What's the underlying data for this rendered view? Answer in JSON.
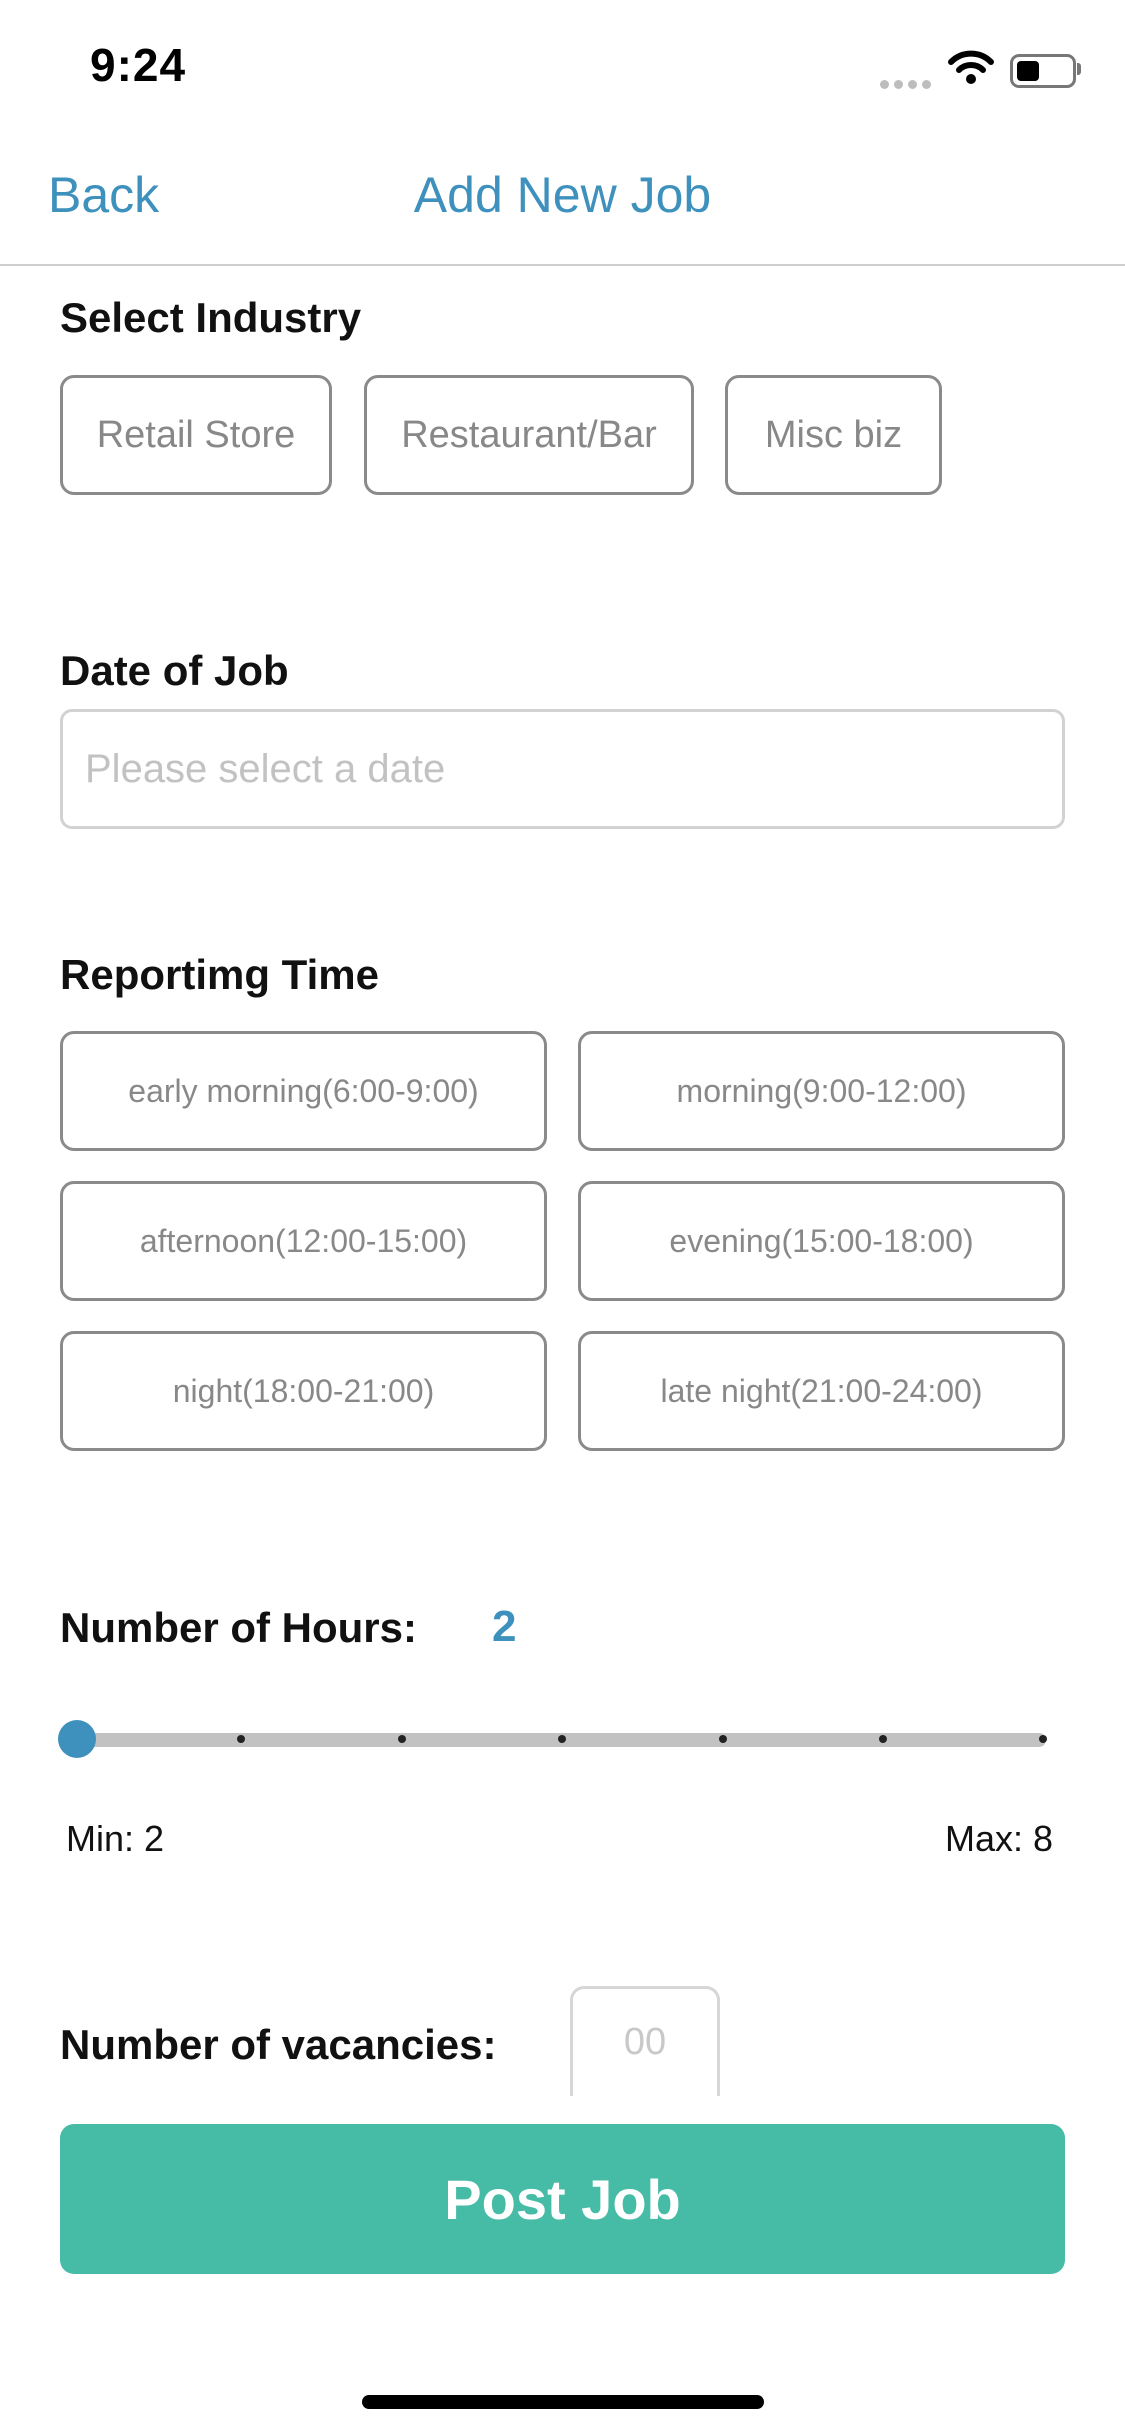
{
  "status_bar": {
    "time": "9:24"
  },
  "nav": {
    "back_label": "Back",
    "title": "Add New Job"
  },
  "industry": {
    "label": "Select Industry",
    "options": [
      "Retail Store",
      "Restaurant/Bar",
      "Misc biz"
    ]
  },
  "date": {
    "label": "Date of Job",
    "placeholder": "Please select a date"
  },
  "reporting": {
    "label": "Reportimg Time",
    "options": [
      "early morning(6:00-9:00)",
      "morning(9:00-12:00)",
      "afternoon(12:00-15:00)",
      "evening(15:00-18:00)",
      "night(18:00-21:00)",
      "late night(21:00-24:00)"
    ]
  },
  "hours": {
    "label": "Number of Hours:",
    "value": "2",
    "min_label": "Min: 2",
    "max_label": "Max: 8",
    "min": 2,
    "max": 8
  },
  "vacancies": {
    "label": "Number of vacancies:",
    "placeholder": "00"
  },
  "post_button": "Post Job",
  "colors": {
    "accent": "#3e91bd",
    "primary_button": "#46bca6"
  }
}
